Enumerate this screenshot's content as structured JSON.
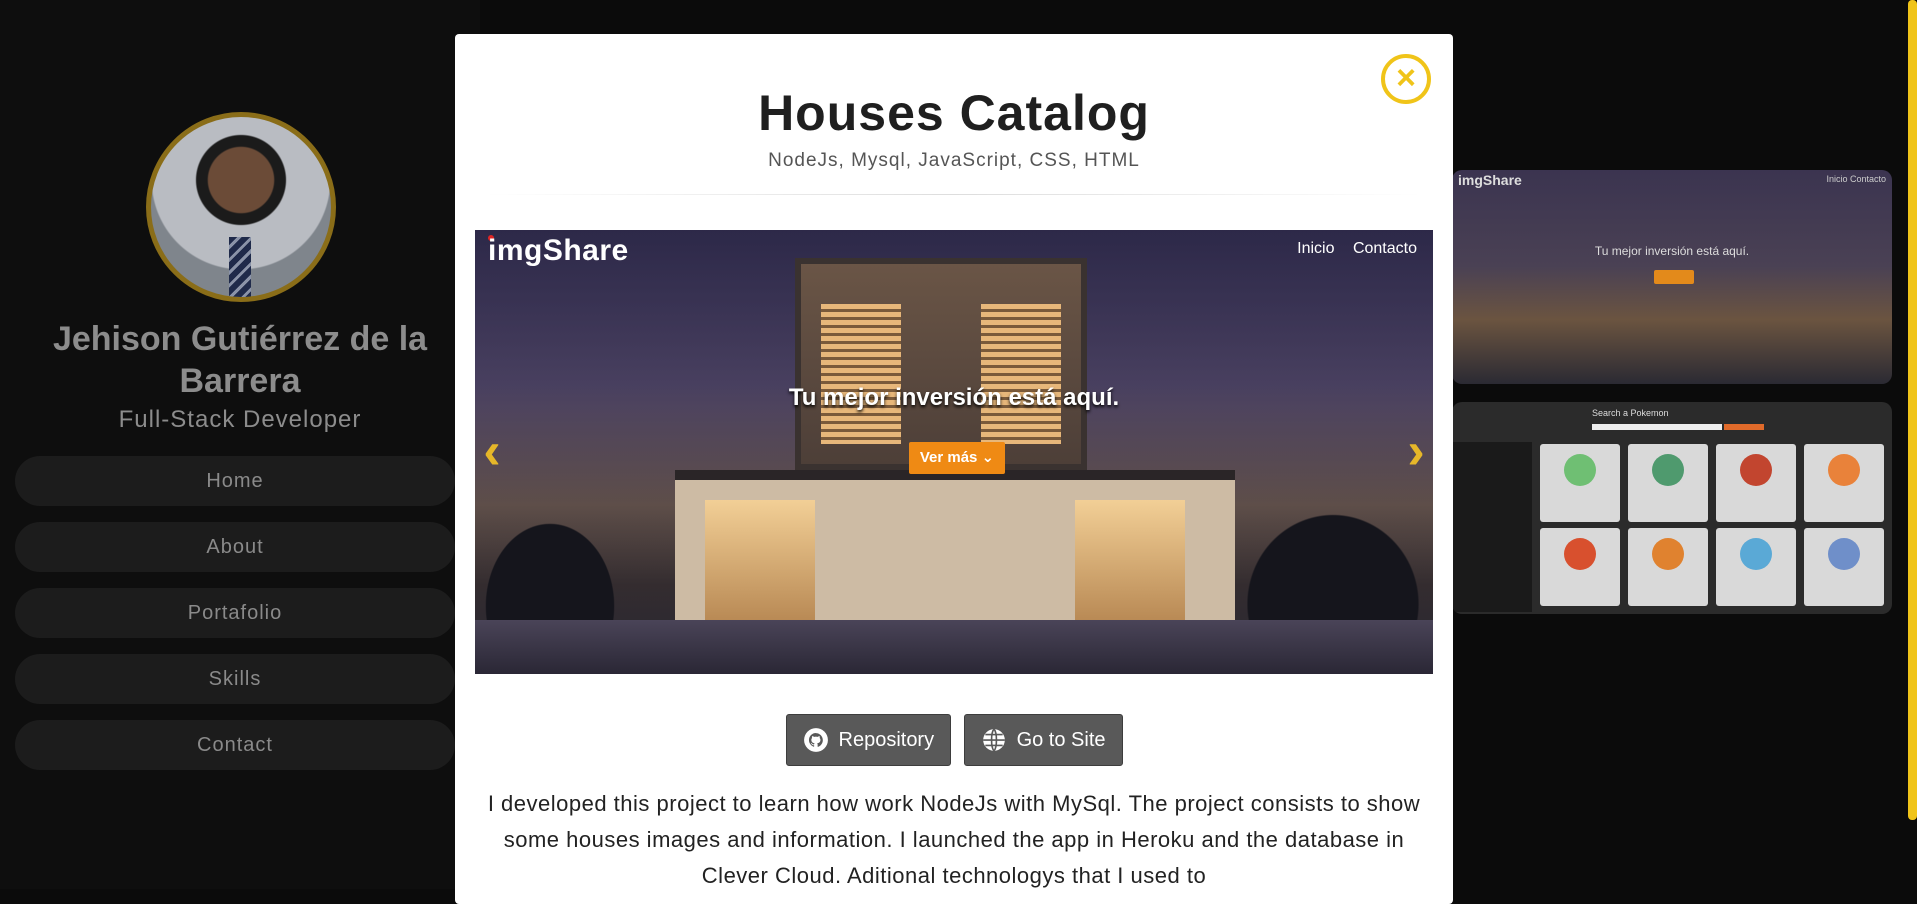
{
  "profile": {
    "name": "Jehison Gutiérrez de la Barrera",
    "role": "Full-Stack Developer"
  },
  "nav": {
    "items": [
      {
        "label": "Home"
      },
      {
        "label": "About"
      },
      {
        "label": "Portafolio"
      },
      {
        "label": "Skills"
      },
      {
        "label": "Contact"
      }
    ]
  },
  "background_thumbs": {
    "house": {
      "logo": "imgShare",
      "nav": "Inicio  Contacto",
      "headline": "Tu mejor inversión está aquí."
    },
    "pokemon": {
      "search_label": "Search a Pokemon"
    }
  },
  "modal": {
    "close_icon": "close-icon",
    "title": "Houses Catalog",
    "stack": "NodeJs, Mysql, JavaScript, CSS, HTML",
    "carousel": {
      "logo": "imgShare",
      "nav": [
        "Inicio",
        "Contacto"
      ],
      "headline": "Tu mejor inversión está aquí.",
      "cta": "Ver más ⌄",
      "prev_icon": "chevron-left-icon",
      "next_icon": "chevron-right-icon"
    },
    "buttons": {
      "repository": "Repository",
      "site": "Go to Site"
    },
    "description": "I developed this project to learn how work NodeJs with MySql. The project consists to show some houses images and information. I launched the app in Heroku and the database in Clever Cloud. Aditional technologys that I used to"
  },
  "colors": {
    "accent": "#f0c419",
    "cta": "#ef8a14",
    "button_bg": "#595959"
  }
}
